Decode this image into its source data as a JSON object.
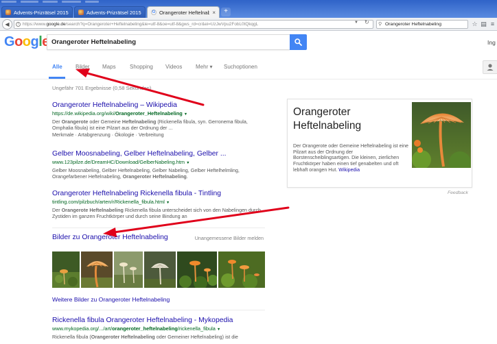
{
  "browser": {
    "tabs": [
      {
        "label": "Advents-Prizrätsel 2015",
        "active": false
      },
      {
        "label": "Advents-Prizrätsel 2015",
        "active": false
      },
      {
        "label": "Orangeroter Heftelnabeli...",
        "active": true
      }
    ],
    "tab_close_glyph": "×",
    "new_tab_glyph": "+",
    "url_prefix": "https://www.",
    "url_domain": "google.de",
    "url_rest": "/search?q=Orangeroter+Heftelnabeling&ie=utf-8&oe=utf-8&gws_rd=cr&ei=UzJwVpu2FobL0tQkqgL",
    "search_box_value": "Orangeroter Heftelnabeling",
    "icons": [
      "back-icon",
      "info-icon",
      "dropdown-caret-icon",
      "reload-icon",
      "search-icon",
      "bookmark-star-icon",
      "clipboard-icon",
      "menu-icon"
    ]
  },
  "google": {
    "logo_letters": [
      {
        "ch": "G",
        "color": "#4285f4"
      },
      {
        "ch": "o",
        "color": "#ea4335"
      },
      {
        "ch": "o",
        "color": "#fbbc05"
      },
      {
        "ch": "g",
        "color": "#4285f4"
      },
      {
        "ch": "l",
        "color": "#34a853"
      },
      {
        "ch": "e",
        "color": "#ea4335"
      }
    ],
    "query": "Orangeroter Heftelnabeling",
    "signin_name": "Ing",
    "search_button_color": "#4285f4",
    "nav": [
      {
        "label": "Alle",
        "active": true
      },
      {
        "label": "Bilder",
        "active": false
      },
      {
        "label": "Maps",
        "active": false
      },
      {
        "label": "Shopping",
        "active": false
      },
      {
        "label": "Videos",
        "active": false
      },
      {
        "label": "Mehr ▾",
        "active": false
      },
      {
        "label": "Suchoptionen",
        "active": false
      }
    ]
  },
  "stats": "Ungefähr 701 Ergebnisse (0,58 Sekunden)",
  "results": [
    {
      "title": "Orangeroter Heftelnabeling – Wikipedia",
      "url": [
        {
          "t": "https://de.wikipedia.org/wiki/",
          "b": false
        },
        {
          "t": "Orangeroter_Heftelnabeling",
          "b": true
        }
      ],
      "snippet": [
        {
          "t": "Der ",
          "b": false
        },
        {
          "t": "Orangerote",
          "b": true
        },
        {
          "t": " oder Gemeine ",
          "b": false
        },
        {
          "t": "Heftelnabeling",
          "b": true
        },
        {
          "t": " (Rickenella fibula, syn. Gerronema fibula, Omphalia fibula) ist eine Pilzart aus der Ordnung der ...",
          "b": false
        }
      ],
      "sitelinks": "Merkmale · Artabgrenzung · Ökologie · Verbreitung"
    },
    {
      "title": "Gelber Moosnabeling, Gelber Heftelnabeling, Gelber ...",
      "url": [
        {
          "t": "www.123pilze.de/DreamHC/Download/GelberNabeling.htm",
          "b": false
        }
      ],
      "snippet": [
        {
          "t": "Gelber Moosnabeling, Gelber Heftelnabeling, Gelber Nabeling, Gelber Heftelhelmling, Orangefarbener Heftelnabeling, ",
          "b": false
        },
        {
          "t": "Orangeroter Heftelnabeling",
          "b": true
        },
        {
          "t": ".",
          "b": false
        }
      ],
      "sitelinks": ""
    },
    {
      "title": "Orangeroter Heftelnabeling Rickenella fibula - Tintling",
      "url": [
        {
          "t": "tintling.com/pilzbuch/arten/r/Rickenella_fibula.html",
          "b": false
        }
      ],
      "snippet": [
        {
          "t": "Der ",
          "b": false
        },
        {
          "t": "Orangerote Heftelnabeling",
          "b": true
        },
        {
          "t": " Rickenella fibula unterscheidet sich von den Nabelingen durch Zystiden im ganzen Fruchtkörper und durch seine Bindung an",
          "b": false
        }
      ],
      "sitelinks": ""
    },
    {
      "title": "Rickenella fibula Orangeroter Heftelnabeling - Mykopedia",
      "url": [
        {
          "t": "www.mykopedia.org/.../art/",
          "b": false
        },
        {
          "t": "orangeroter_heftelnabeling",
          "b": true
        },
        {
          "t": "/rickenella_fibula",
          "b": false
        }
      ],
      "snippet": [
        {
          "t": "Rickenella fibula (",
          "b": false
        },
        {
          "t": "Orangeroter Heftelnabeling",
          "b": true
        },
        {
          "t": " oder Gemeiner Heftelnabeling) ist die",
          "b": false
        }
      ],
      "sitelinks": ""
    }
  ],
  "images": {
    "header": "Bilder zu Orangeroter Heftelnabeling",
    "report": "Unangemessene Bilder melden",
    "more": "Weitere Bilder zu Orangeroter Heftelnabeling",
    "thumbnails": [
      "moss-mushroom-photo",
      "orange-mushroom-gills-photo",
      "pale-mushrooms-photo",
      "pale-cap-photo",
      "orange-mushroom-moss-photo",
      "orange-mushroom-moss-photo"
    ]
  },
  "knowledge_panel": {
    "title": "Orangeroter Heftelnabeling",
    "description": "Der Orangerote oder Gemeine Heftelnabeling ist eine Pilzart aus der Ordnung der Borstenscheiblingsartigen. Die kleinen, zierlichen Fruchtkörper haben einen tief genabelten und oft lebhaft orangen Hut. ",
    "source": "Wikipedia",
    "feedback": "Feedback"
  },
  "colors": {
    "link": "#1a0dab",
    "url_green": "#006621",
    "snippet": "#545454",
    "accent_blue": "#4285f4",
    "annotation_red": "#e0001a"
  }
}
